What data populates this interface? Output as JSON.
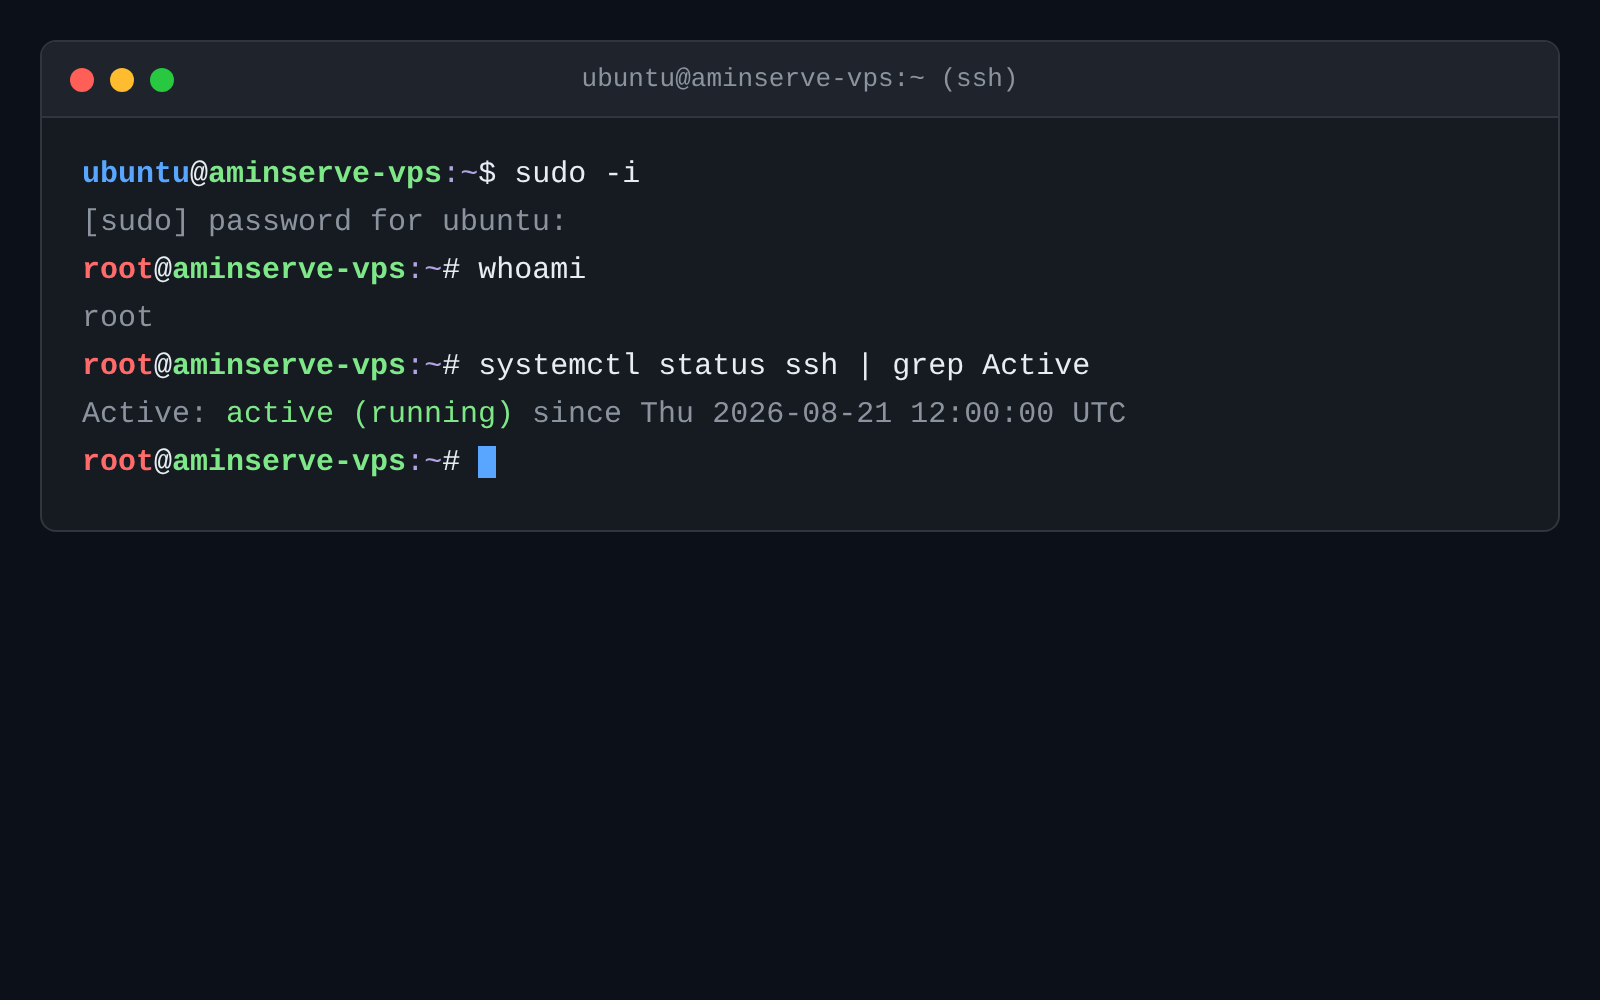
{
  "window": {
    "title": "ubuntu@aminserve-vps:~ (ssh)",
    "controls": [
      {
        "kind": "close"
      },
      {
        "kind": "minimize"
      },
      {
        "kind": "maximize"
      }
    ]
  },
  "lines": [
    {
      "kind": "prompt",
      "superuser": false,
      "user": "ubuntu",
      "at": "@",
      "host": "aminserve-vps",
      "path": ":~",
      "symbol": "$",
      "command": " sudo -i",
      "cursor": false
    },
    {
      "kind": "output",
      "text": "[sudo] password for ubuntu:"
    },
    {
      "kind": "prompt",
      "superuser": true,
      "user": "root",
      "at": "@",
      "host": "aminserve-vps",
      "path": ":~",
      "symbol": "#",
      "command": " whoami",
      "cursor": false
    },
    {
      "kind": "output",
      "text": "root"
    },
    {
      "kind": "prompt",
      "superuser": true,
      "user": "root",
      "at": "@",
      "host": "aminserve-vps",
      "path": ":~",
      "symbol": "#",
      "command": " systemctl status ssh | grep Active",
      "cursor": false
    },
    {
      "kind": "status",
      "label": "Active: ",
      "state": "active (running)",
      "detail": " since Thu 2026-08-21 12:00:00 UTC"
    },
    {
      "kind": "prompt",
      "superuser": true,
      "user": "root",
      "at": "@",
      "host": "aminserve-vps",
      "path": ":~",
      "symbol": "#",
      "cursor": true
    }
  ]
}
